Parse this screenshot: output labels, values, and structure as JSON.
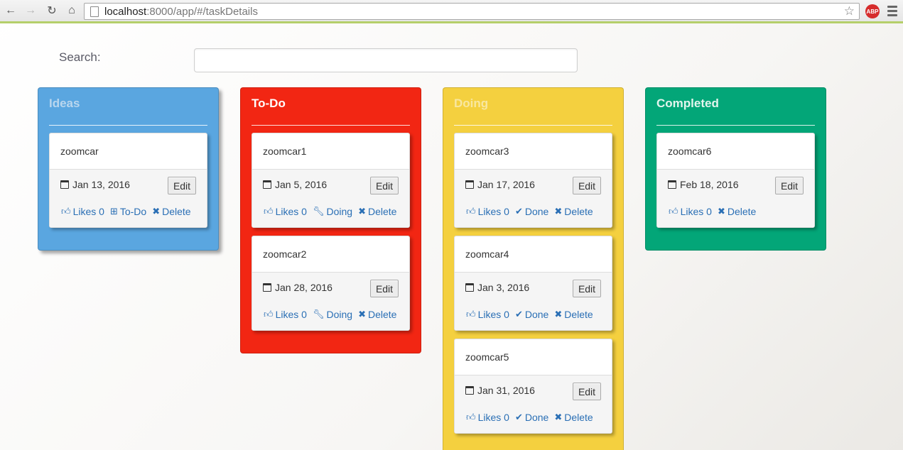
{
  "browser": {
    "url_host": "localhost",
    "url_path": ":8000/app/#/taskDetails",
    "abp_label": "ABP"
  },
  "search": {
    "label": "Search:",
    "value": "",
    "placeholder": ""
  },
  "columns": [
    {
      "title": "Ideas",
      "color": "#5aa6e0",
      "title_color": "#b9d6ee",
      "cards": [
        {
          "name": "zoomcar",
          "date": "Jan 13, 2016",
          "edit": "Edit",
          "likes": "Likes 0",
          "move": "To-Do",
          "delete": "Delete"
        }
      ]
    },
    {
      "title": "To-Do",
      "color": "#f22613",
      "title_color": "#ffffff",
      "cards": [
        {
          "name": "zoomcar1",
          "date": "Jan 5, 2016",
          "edit": "Edit",
          "likes": "Likes 0",
          "move": "Doing",
          "delete": "Delete"
        },
        {
          "name": "zoomcar2",
          "date": "Jan 28, 2016",
          "edit": "Edit",
          "likes": "Likes 0",
          "move": "Doing",
          "delete": "Delete"
        }
      ]
    },
    {
      "title": "Doing",
      "color": "#f4d03f",
      "title_color": "#f8e7a0",
      "cards": [
        {
          "name": "zoomcar3",
          "date": "Jan 17, 2016",
          "edit": "Edit",
          "likes": "Likes 0",
          "move": "Done",
          "delete": "Delete"
        },
        {
          "name": "zoomcar4",
          "date": "Jan 3, 2016",
          "edit": "Edit",
          "likes": "Likes 0",
          "move": "Done",
          "delete": "Delete"
        },
        {
          "name": "zoomcar5",
          "date": "Jan 31, 2016",
          "edit": "Edit",
          "likes": "Likes 0",
          "move": "Done",
          "delete": "Delete"
        }
      ]
    },
    {
      "title": "Completed",
      "color": "#03a678",
      "title_color": "#e3f5ee",
      "cards": [
        {
          "name": "zoomcar6",
          "date": "Feb 18, 2016",
          "edit": "Edit",
          "likes": "Likes 0",
          "delete": "Delete"
        }
      ]
    }
  ]
}
